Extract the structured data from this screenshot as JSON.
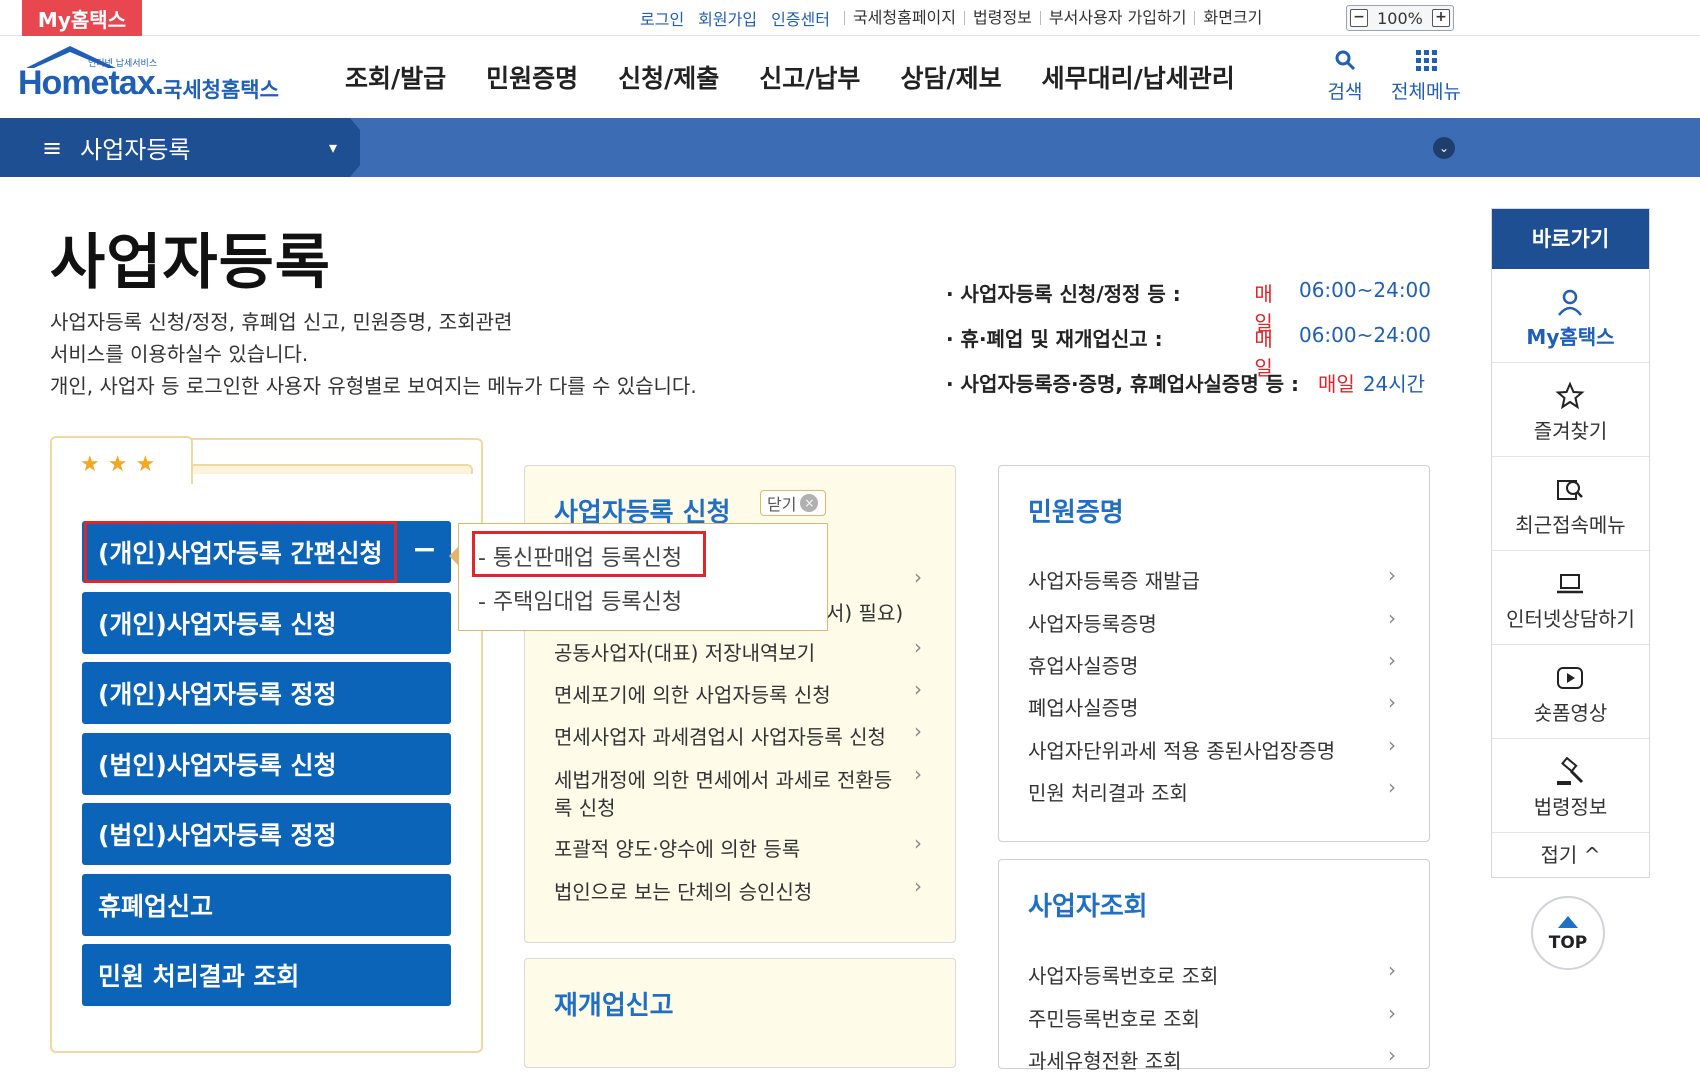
{
  "topbar": {
    "my_hometax": "My홈택스",
    "links_blue": [
      "로그인",
      "회원가입",
      "인증센터"
    ],
    "links_gray": [
      "국세청홈페이지",
      "법령정보",
      "부서사용자 가입하기",
      "화면크기"
    ],
    "zoom_minus": "−",
    "zoom_value": "100%",
    "zoom_plus": "+"
  },
  "header": {
    "logo_small": "인터넷 납세서비스",
    "logo_main": "Hometax.",
    "logo_sub": "국세청홈택스",
    "nav": [
      "조회/발급",
      "민원증명",
      "신청/제출",
      "신고/납부",
      "상담/제보",
      "세무대리/납세관리"
    ],
    "search_label": "검색",
    "allmenu_label": "전체메뉴"
  },
  "subnav": {
    "menu_icon": "≡",
    "title": "사업자등록",
    "dropdown_icon": "▾",
    "expand_icon": "⌄"
  },
  "page": {
    "title": "사업자등록",
    "desc_lines": [
      "사업자등록 신청/정정, 휴폐업 신고, 민원증명, 조회관련",
      "서비스를 이용하실수 있습니다.",
      "개인, 사업자 등 로그인한 사용자 유형별로 보여지는 메뉴가 다를 수 있습니다."
    ],
    "hours": [
      {
        "label": "· 사업자등록 신청/정정 등 :",
        "day": "매일",
        "time": "06:00~24:00"
      },
      {
        "label": "· 휴·폐업 및 재개업신고 :",
        "day": "매일",
        "time": "06:00~24:00"
      },
      {
        "label": "· 사업자등록증·증명, 휴폐업사실증명 등 :",
        "day": "매일",
        "time": "24시간"
      }
    ]
  },
  "favorites": {
    "stars": "★★★",
    "buttons": [
      "(개인)사업자등록 간편신청",
      "(개인)사업자등록 신청",
      "(개인)사업자등록 정정",
      "(법인)사업자등록 신청",
      "(법인)사업자등록 정정",
      "휴폐업신고",
      "민원 처리결과 조회"
    ],
    "collapse_icon": "−"
  },
  "popup": {
    "items": [
      "- 통신판매업 등록신청",
      "- 주택임대업 등록신청"
    ]
  },
  "apply_panel": {
    "title": "사업자등록 신청",
    "close_label": "닫기",
    "close_icon": "×",
    "partial_text": "서) 필요)",
    "items": [
      "공동사업자(대표) 저장내역보기",
      "면세포기에 의한 사업자등록 신청",
      "면세사업자 과세겸업시 사업자등록 신청",
      "세법개정에 의한 면세에서 과세로 전환등",
      "록 신청",
      "포괄적 양도·양수에 의한 등록",
      "법인으로 보는 단체의 승인신청"
    ]
  },
  "reopen_panel": {
    "title": "재개업신고"
  },
  "cert_panel": {
    "title": "민원증명",
    "items": [
      "사업자등록증 재발급",
      "사업자등록증명",
      "휴업사실증명",
      "폐업사실증명",
      "사업자단위과세 적용 종된사업장증명",
      "민원 처리결과 조회"
    ]
  },
  "lookup_panel": {
    "title": "사업자조회",
    "items": [
      "사업자등록번호로 조회",
      "주민등록번호로 조회",
      "과세유형전환 조회"
    ]
  },
  "chevron": "›",
  "quick": {
    "title": "바로가기",
    "items": [
      "My홈택스",
      "즐겨찾기",
      "최근접속메뉴",
      "인터넷상담하기",
      "숏폼영상",
      "법령정보"
    ],
    "fold": "접기 ^",
    "top": "TOP"
  },
  "colors": {
    "brand_blue": "#0b64b8",
    "nav_dark": "#1f4f93",
    "highlight_red": "#e0262b"
  }
}
